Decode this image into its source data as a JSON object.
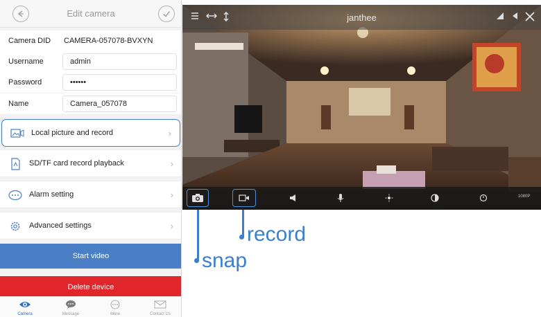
{
  "phone": {
    "title": "Edit camera",
    "fields": {
      "did_label": "Camera DID",
      "did_value": "CAMERA-057078-BVXYN",
      "username_label": "Username",
      "username_value": "admin",
      "password_label": "Password",
      "password_value": "••••••",
      "name_label": "Name",
      "name_value": "Camera_057078"
    },
    "menu": {
      "local": "Local picture and record",
      "sd": "SD/TF card record playback",
      "alarm": "Alarm setting",
      "advanced": "Advanced settings",
      "chevron": "›"
    },
    "start_video": "Start video",
    "delete_device": "Delete device",
    "tabs": {
      "camera": "Camera",
      "message": "Message",
      "more": "More",
      "contact": "Contact Us"
    }
  },
  "video": {
    "camera_name": "janthee",
    "quality": "1080P"
  },
  "annotations": {
    "snap": "snap",
    "record": "record"
  },
  "colors": {
    "accent": "#3b7fd0",
    "start_video": "#4a7ec6",
    "delete": "#e0262b"
  },
  "icons": [
    "back-icon",
    "check-icon",
    "picture-icon",
    "sd-card-icon",
    "alarm-icon",
    "gear-icon",
    "camera-tab-icon",
    "message-icon",
    "more-icon",
    "contact-icon",
    "menu-icon",
    "horizontal-flip-icon",
    "vertical-flip-icon",
    "signal-icon",
    "volume-icon",
    "close-icon",
    "camera-icon",
    "video-record-icon",
    "speaker-icon",
    "microphone-icon",
    "brightness-icon",
    "contrast-icon",
    "reset-icon"
  ]
}
